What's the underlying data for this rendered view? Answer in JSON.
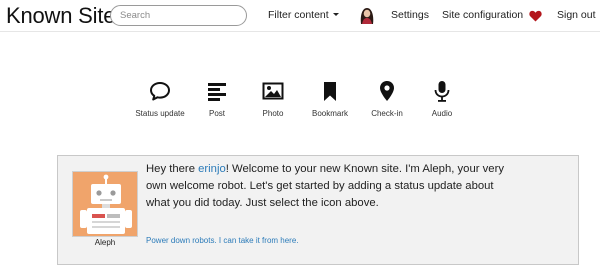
{
  "navbar": {
    "brand": "Known Site",
    "search_placeholder": "Search",
    "filter_label": "Filter content",
    "settings_label": "Settings",
    "site_config_label": "Site configuration",
    "sign_out_label": "Sign out",
    "heart_color": "#b3161c",
    "icons": [
      "user-avatar",
      "caret-down-icon",
      "heart-icon"
    ]
  },
  "content_types": [
    {
      "label": "Status update",
      "icon": "speech-bubble-icon"
    },
    {
      "label": "Post",
      "icon": "align-left-icon"
    },
    {
      "label": "Photo",
      "icon": "picture-icon"
    },
    {
      "label": "Bookmark",
      "icon": "bookmark-icon"
    },
    {
      "label": "Check-in",
      "icon": "map-marker-icon"
    },
    {
      "label": "Audio",
      "icon": "microphone-icon"
    }
  ],
  "welcome": {
    "greeting_prefix": "Hey there ",
    "username": "erinjo",
    "message": "! Welcome to your new Known site. I'm Aleph, your very own welcome robot. Let's get started by adding a status update about what you did today. Just select the icon above.",
    "robot_name": "Aleph",
    "power_down_link": "Power down robots. I can take it from here.",
    "link_color": "#2b7bb9",
    "robot_bg_color": "#f0a46b"
  }
}
